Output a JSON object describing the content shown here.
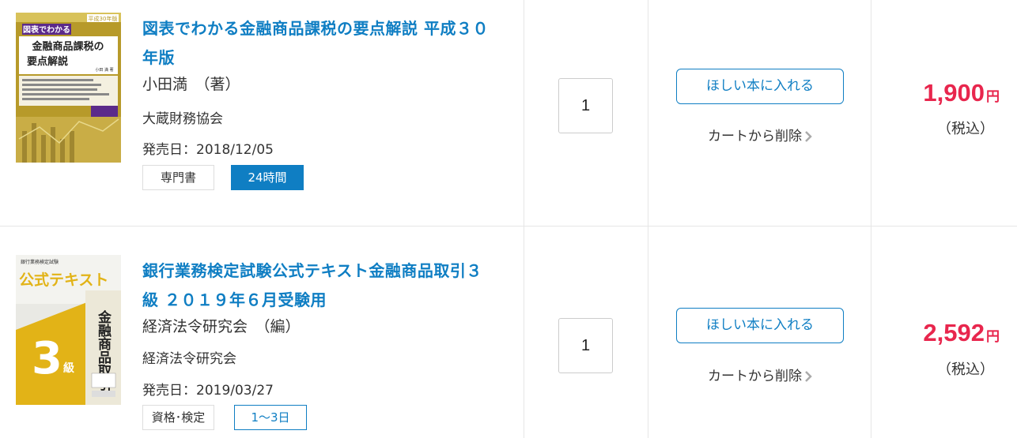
{
  "items": [
    {
      "title": "図表でわかる金融商品課税の要点解説 平成３０年版",
      "author": "小田満　（著）",
      "publisher": "大蔵財務協会",
      "release": "発売日：2018/12/05",
      "tag_genre": "専門書",
      "tag_shipping": "24時間",
      "quantity": "1",
      "wish_label": "ほしい本に入れる",
      "delete_label": "カートから削除",
      "price": "1,900",
      "price_unit": "円",
      "tax_label": "（税込）",
      "cover": {
        "line1": "図表でわかる",
        "line2": "金融商品課税の",
        "line3": "要点解説",
        "badge": "平成30年版",
        "author": "小田 満 著"
      }
    },
    {
      "title": "銀行業務検定試験公式テキスト金融商品取引３級 ２０１９年６月受験用",
      "author": "経済法令研究会　（編）",
      "publisher": "経済法令研究会",
      "release": "発売日：2019/03/27",
      "tag_genre": "資格･検定",
      "tag_shipping": "1～3日",
      "quantity": "1",
      "wish_label": "ほしい本に入れる",
      "delete_label": "カートから削除",
      "price": "2,592",
      "price_unit": "円",
      "tax_label": "（税込）",
      "cover": {
        "top": "銀行業務検定試験",
        "heading": "公式テキスト",
        "grade": "3",
        "grade_suffix": "級",
        "vertical": "金融商品取引"
      }
    }
  ]
}
